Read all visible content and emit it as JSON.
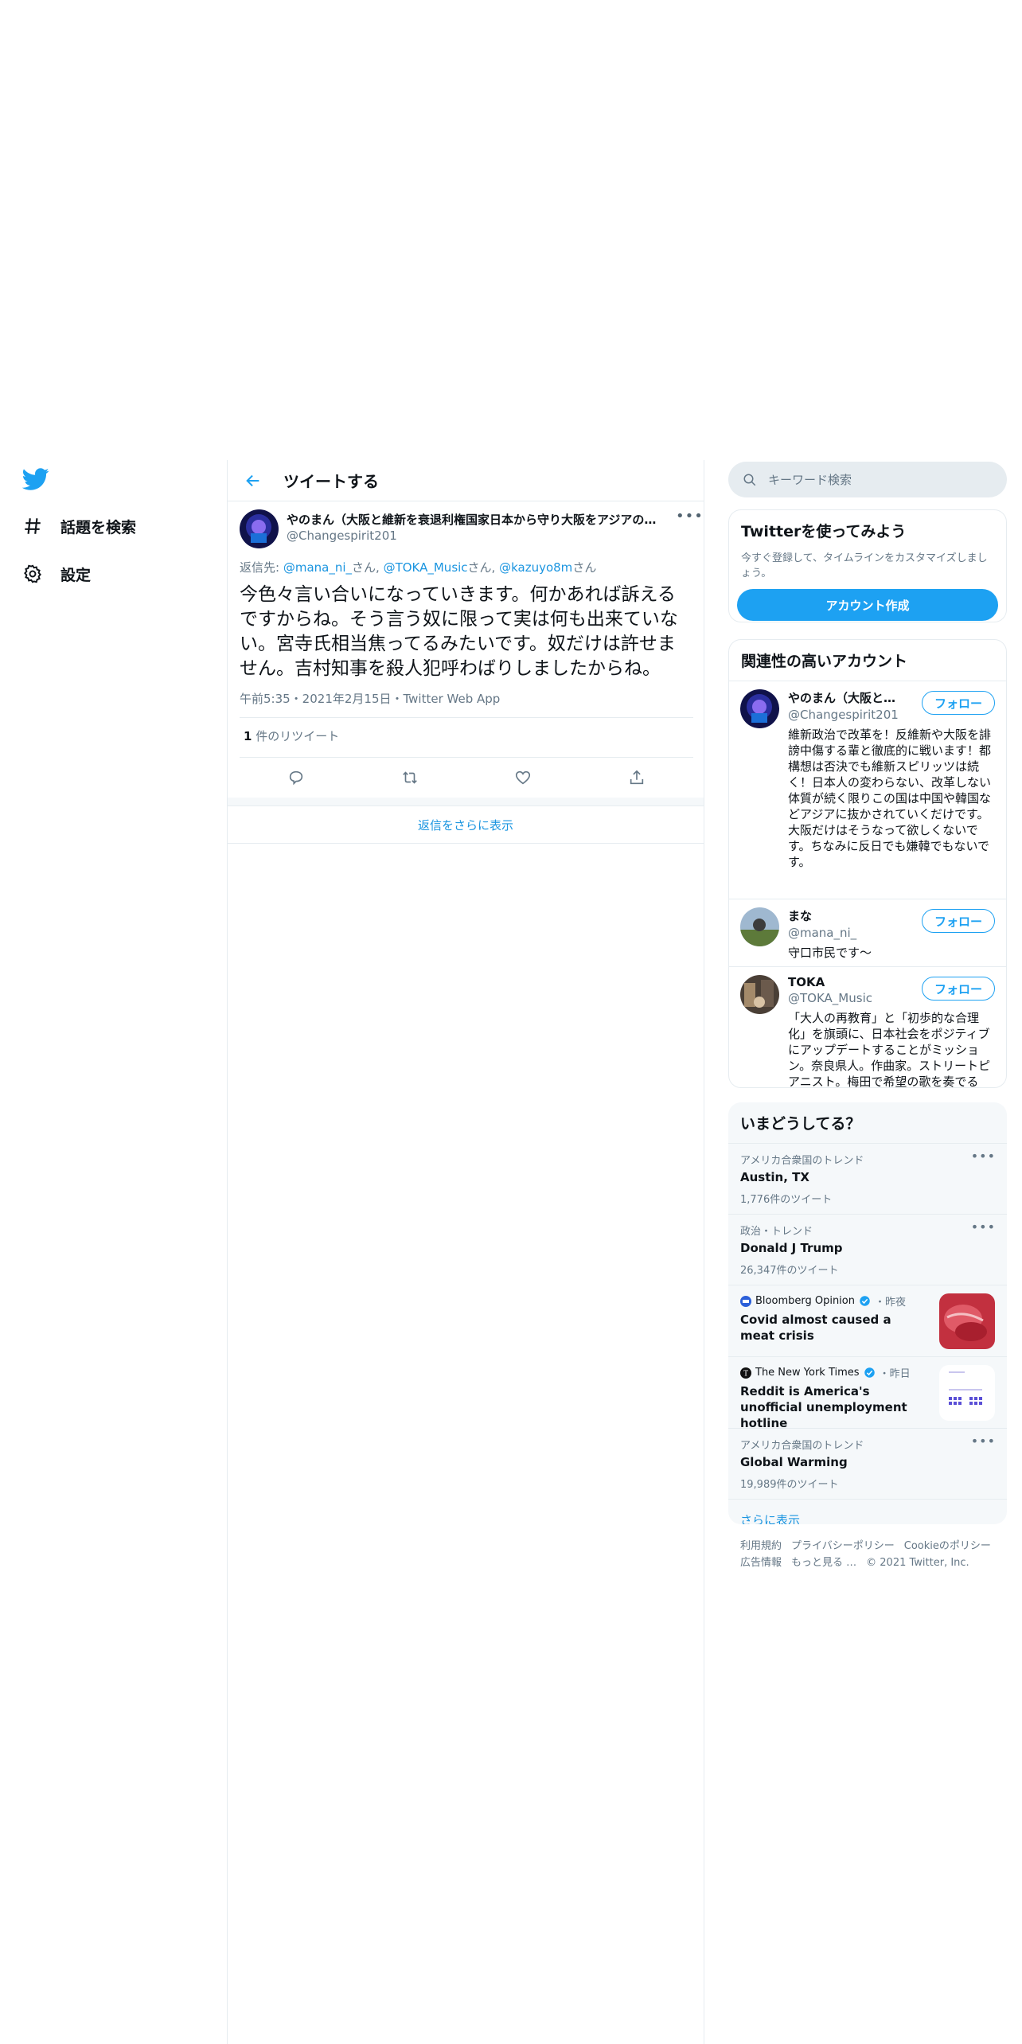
{
  "nav": {
    "items": [
      {
        "label": "話題を検索",
        "icon": "hashtag-icon"
      },
      {
        "label": "設定",
        "icon": "gear-icon"
      }
    ]
  },
  "main": {
    "header_title": "ツイートする",
    "tweet": {
      "name": "やのまん（大阪と維新を衰退利権国家日本から守り大阪をアジアの…",
      "handle": "@Changespirit201",
      "reply_prefix": "返信先: ",
      "reply_to": [
        {
          "handle": "@mana_ni_",
          "suffix": "さん, "
        },
        {
          "handle": "@TOKA_Music",
          "suffix": "さん, "
        },
        {
          "handle": "@kazuyo8m",
          "suffix": "さん"
        }
      ],
      "text": "今色々言い合いになっていきます。何かあれば訴えるですからね。そう言う奴に限って実は何も出来ていない。宮寺氏相当焦ってるみたいです。奴だけは許せません。吉村知事を殺人犯呼わばりしましたからね。",
      "meta": "午前5:35・2021年2月15日・Twitter Web App",
      "retweet_count": "1",
      "retweet_label": " 件のリツイート"
    },
    "show_more_replies": "返信をさらに表示"
  },
  "sidebar": {
    "search_placeholder": "キーワード検索",
    "signup": {
      "title": "Twitterを使ってみよう",
      "subtitle": "今すぐ登録して、タイムラインをカスタマイズしましょう。",
      "button": "アカウント作成"
    },
    "related": {
      "title": "関連性の高いアカウント",
      "follow_label": "フォロー",
      "accounts": [
        {
          "name": "やのまん（大阪と維新を衰退利権国家日本から守り…",
          "handle": "@Changespirit201",
          "bio": "維新政治で改革を！反維新や大阪を誹謗中傷する輩と徹底的に戦います！都構想は否決でも維新スピリッツは続く！日本人の変わらない、改革しない体質が続く限りこの国は中国や韓国などアジアに抜かされていくだけです。大阪だけはそうなって欲しくないです。ちなみに反日でも嫌韓でもないです。"
        },
        {
          "name": "まな",
          "handle": "@mana_ni_",
          "bio": "守口市民です〜"
        },
        {
          "name": "TOKA",
          "handle": "@TOKA_Music",
          "bio": "「大人の再教育」と「初歩的な合理化」を旗頭に、日本社会をポジティブにアップデートすることがミッション。奈良県人。作曲家。ストリートピアニスト。梅田で希望の歌を奏でる人。"
        }
      ]
    },
    "trends": {
      "title": "いまどうしてる？",
      "items": [
        {
          "context": "アメリカ合衆国のトレンド",
          "name": "Austin, TX",
          "count": "1,776件のツイート"
        },
        {
          "context": "政治・トレンド",
          "name": "Donald J Trump",
          "count": "26,347件のツイート"
        }
      ],
      "news": [
        {
          "source": "Bloomberg Opinion",
          "time": "・昨夜",
          "title": "Covid almost caused a meat crisis"
        },
        {
          "source": "The New York Times",
          "time": "・昨日",
          "title": "Reddit is America's unofficial unemployment hotline"
        }
      ],
      "trend_last": {
        "context": "アメリカ合衆国のトレンド",
        "name": "Global Warming",
        "count": "19,989件のツイート"
      },
      "show_more": "さらに表示"
    },
    "footer": {
      "links": [
        "利用規約",
        "プライバシーポリシー",
        "Cookieのポリシー",
        "広告情報",
        "もっと見る …"
      ],
      "copyright": "© 2021 Twitter, Inc."
    }
  },
  "colors": {
    "accent": "#1da1f2",
    "link": "#1b95e0",
    "border": "#e6ecf0",
    "muted": "#657786"
  }
}
